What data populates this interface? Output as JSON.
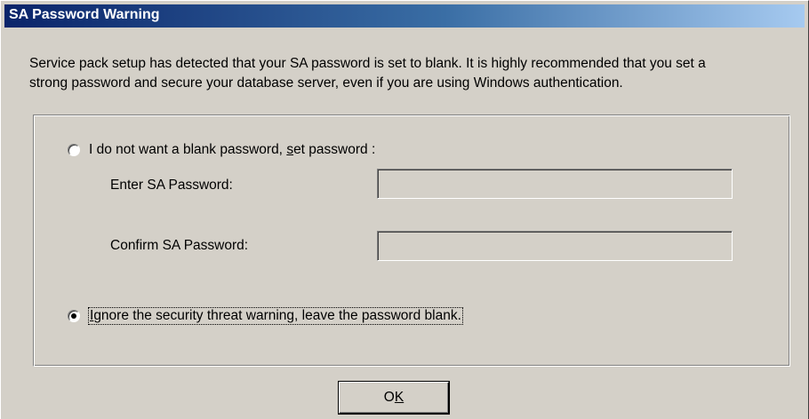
{
  "window": {
    "title": "SA Password Warning"
  },
  "message": {
    "line1": "Service pack setup has detected that your SA password is set to blank. It is highly recommended that you set a",
    "line2": "strong password and secure your database server, even if you are using Windows authentication."
  },
  "options": {
    "set_password": {
      "label_before": "I do not want a blank password, ",
      "label_accel": "s",
      "label_after": "et password :",
      "selected": false
    },
    "ignore": {
      "label_accel": "I",
      "label_after": "gnore the security threat warning, leave the password blank.",
      "selected": true
    }
  },
  "fields": {
    "enter_label": "Enter SA Password:",
    "enter_value": "",
    "confirm_label": "Confirm SA Password:",
    "confirm_value": ""
  },
  "buttons": {
    "ok_before": "O",
    "ok_accel": "K"
  },
  "colors": {
    "dialog_bg": "#d4d0c8",
    "title_start": "#0a246a",
    "title_end": "#a6caf0"
  }
}
